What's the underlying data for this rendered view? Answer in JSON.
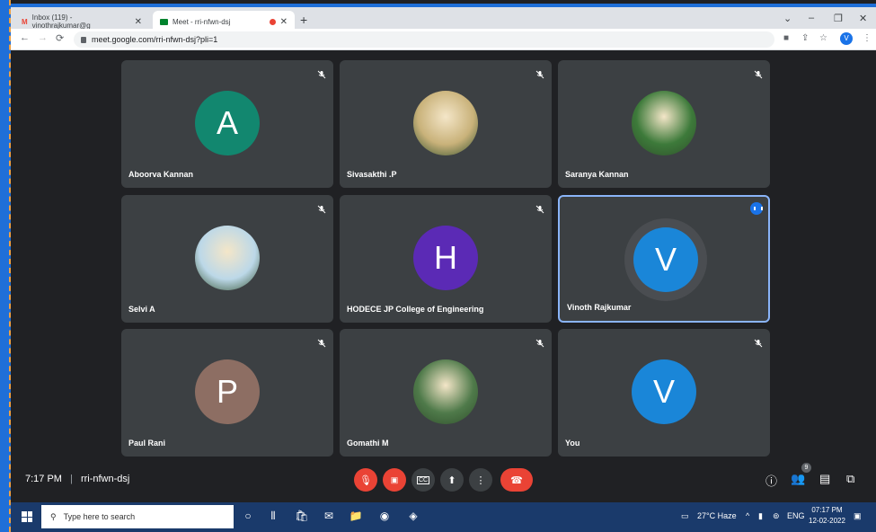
{
  "browser": {
    "tabs": [
      {
        "title": "Inbox (119) - vinothrajkumar@g",
        "active": false
      },
      {
        "title": "Meet - rri-nfwn-dsj",
        "active": true
      }
    ],
    "url": "meet.google.com/rri-nfwn-dsj?pli=1",
    "profile_initial": "V"
  },
  "participants": [
    {
      "name": "Aboorva Kannan",
      "initial": "A",
      "color": "#12876f",
      "photo": false,
      "muted": true
    },
    {
      "name": "Sivasakthi .P",
      "initial": "",
      "color": "#c9b27a",
      "photo": true,
      "muted": true
    },
    {
      "name": "Saranya Kannan",
      "initial": "",
      "color": "#3d7a3a",
      "photo": true,
      "muted": true
    },
    {
      "name": "Selvi A",
      "initial": "",
      "color": "#bcd8e8",
      "photo": true,
      "muted": true
    },
    {
      "name": "HODECE JP College of Engineering",
      "initial": "H",
      "color": "#5b2ab5",
      "photo": false,
      "muted": true
    },
    {
      "name": "Vinoth Rajkumar",
      "initial": "V",
      "color": "#1a86d8",
      "photo": false,
      "muted": false,
      "speaking": true
    },
    {
      "name": "Paul Rani",
      "initial": "P",
      "color": "#8d6e63",
      "photo": false,
      "muted": true
    },
    {
      "name": "Gomathi M",
      "initial": "",
      "color": "#4f7a4a",
      "photo": true,
      "muted": true
    },
    {
      "name": "You",
      "initial": "V",
      "color": "#1a86d8",
      "photo": false,
      "muted": true
    }
  ],
  "meeting": {
    "time": "7:17 PM",
    "separator": "|",
    "code": "rri-nfwn-dsj",
    "people_count": "9"
  },
  "taskbar": {
    "search_placeholder": "Type here to search",
    "weather": "27°C  Haze",
    "lang": "ENG",
    "clock_time": "07:17 PM",
    "clock_date": "12-02-2022"
  },
  "colors": {
    "meet_bg": "#202124",
    "tile_bg": "#3c4043",
    "danger": "#ea4335",
    "speaking_border": "#8ab4f8"
  }
}
